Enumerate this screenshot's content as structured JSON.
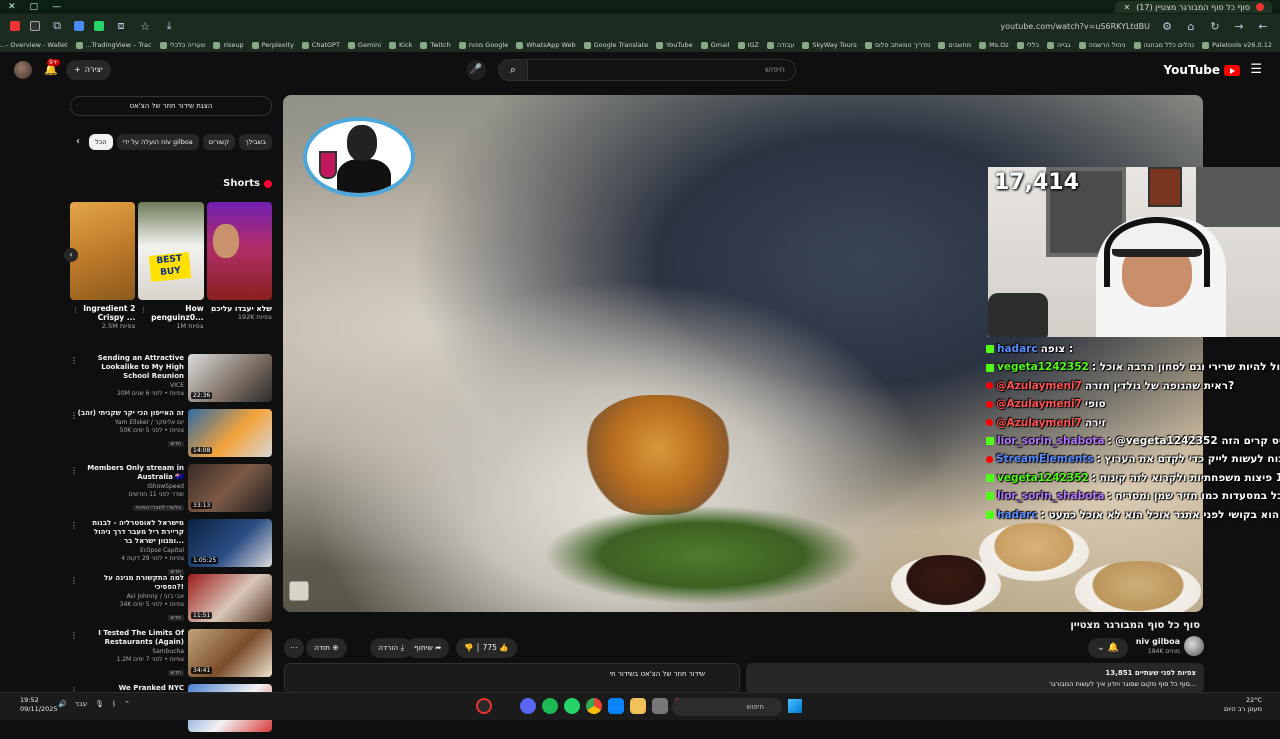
{
  "browser": {
    "tab_title": "(17) סוף כל סוף המבורגר מצטיין",
    "url": "youtube.com/watch?v=uS6RKYLtdBU",
    "bookmarks": [
      "Paletools v26.0.12",
      "נהלים כלל מבחנה",
      "ניהול הרשמה",
      "גבייה",
      "כללי",
      "Ms.Oz",
      "מחשבים",
      "מדריך המאתב פלוס",
      "SkyWay Tours",
      "עבודה",
      "IGZ",
      "Gmail",
      "YouTube",
      "Google Translate",
      "WhatsApp Web",
      "Google מפות",
      "Twitch",
      "Kick",
      "Gemini",
      "ChatGPT",
      "Perplexity",
      "riseup",
      "שעריה כלכלי",
      "TradingView – Trac...",
      "Overview - Wallet -...",
      "אימטרטסקוקים ישראל...",
      "דרך פנס - לוחזר דיווה",
      "עולם כל תכניות נחל..."
    ]
  },
  "masthead": {
    "logo_text": "YouTube",
    "search_placeholder": "חיפוש",
    "search_value": "",
    "create_label": "יצירה",
    "notif_count": "9+"
  },
  "secondary": {
    "live_chat_replay": "הצגת שידור חוזר של הצ'אט",
    "chips": [
      {
        "label": "הכל",
        "active": true
      },
      {
        "label": "הועלה על ידי niv gilboa",
        "active": false
      },
      {
        "label": "קשורים",
        "active": false
      },
      {
        "label": "בשבילך",
        "active": false
      }
    ],
    "shorts_title": "Shorts",
    "shorts": [
      {
        "title": "שלא יעבדו עליכם",
        "views": "192K צפיות"
      },
      {
        "title": "How penguinz0...",
        "views": "1M צפיות"
      },
      {
        "title": "Ingredient 2 Crispy ...",
        "views": "2.5M צפיות"
      }
    ],
    "videos": [
      {
        "title": "Sending an Attractive Lookalike to My High School Reunion",
        "channel": "VICE",
        "stats": "20M צפיות • לפני 6 שנים",
        "duration": "22:36",
        "tag": ""
      },
      {
        "title": "זה האייפון הכי יקר שקניתי (זהב)",
        "channel": "Yam Ellsker / יום אליסקר",
        "stats": "50K צפיות • לפני 5 ימים",
        "duration": "14:08",
        "tag": "חדש"
      },
      {
        "title": "Members Only stream in Australia 🇦🇺",
        "channel": "IShowSpeed",
        "stats": "שודר לפני 11 חודשים",
        "duration": "33:13",
        "tag": "בלעדי לחברי המינוי"
      },
      {
        "title": "מישראל לאוסטרליה - לבנות קריירת ריל מעבר דרך ניהול ומגוון ישראל בר...",
        "channel": "Eclipse Capital",
        "stats": "4 צפיות • לפני 29 דקות",
        "duration": "1:05:25",
        "tag": "חדש"
      },
      {
        "title": "למה התקשורת מגינה על הפסיכי?!",
        "channel": "Avi Johnny / אבי ג'וני",
        "stats": "34K צפיות • לפני 5 ימים",
        "duration": "11:51",
        "tag": "חדש"
      },
      {
        "title": "I Tested The Limits Of Restaurants (Again)",
        "channel": "Sambucha",
        "stats": "1.2M צפיות • לפני 7 ימים",
        "duration": "34:41",
        "tag": "חדש"
      },
      {
        "title": "We Pranked NYC Scammers!",
        "channel": "MindSquare",
        "stats": "",
        "duration": "",
        "tag": ""
      }
    ]
  },
  "overlay": {
    "viewer_count": "17,414",
    "chat": [
      {
        "platform": "kick",
        "user": "hadarc",
        "color": "blue",
        "text": "צופה :"
      },
      {
        "platform": "kick",
        "user": "vegeta1242352",
        "color": "green",
        "text": ": פיס קרים יכול להיות שרירי וגם לסחון הרבה אוכל"
      },
      {
        "platform": "yt",
        "user": "@Azulaymeni7",
        "color": "red",
        "text": "ראית שהגופה של גולדין חזרה?"
      },
      {
        "platform": "yt",
        "user": "@Azulaymeni7",
        "color": "red",
        "text": "סופי"
      },
      {
        "platform": "yt",
        "user": "@Azulaymeni7",
        "color": "red",
        "text": "זירה"
      },
      {
        "platform": "kick",
        "user": "lior_sorin_shabota",
        "color": "purple",
        "text": ": @vegeta1242352 חולה נפש הפיס קרים הזה"
      },
      {
        "platform": "yt",
        "user": "StreamElements",
        "color": "blue",
        "text": ": לא לשכוח לעשות לייק כדי לקדם את הערוץ"
      },
      {
        "platform": "kick",
        "user": "vegeta1242352",
        "color": "green",
        "text": ": דוק איזה 10 פיצות משפחתיות ולקרוא לזה קינוח"
      },
      {
        "platform": "kick",
        "user": "lior_sorin_shabota",
        "color": "purple",
        "text": ": על עשור אוכל במסעדות כמו חזיר שמן ומסריח"
      },
      {
        "platform": "kick",
        "user": "hadarc",
        "color": "blue",
        "text": ": קלוריות וגם הוא בקושי לפני אתגר אוכל הוא לא אוכל כמעט"
      }
    ]
  },
  "video": {
    "title": "סוף כל סוף המבורגר מצטיין",
    "channel_name": "niv gilboa",
    "subscribers": "184K מנויים",
    "likes": "775",
    "share_label": "שיתוף",
    "download_label": "הורדה",
    "thanks_label": "תודה",
    "description_stats": "13,851 צפיות  לפני שעתיים",
    "description_text": "סוף כל סוף מקום שסוגר ויודע איך לעשות המבורגר...",
    "chat_replay_label": "שידור חוזר של הצ'אט בשידור חי"
  },
  "taskbar": {
    "time": "19:52",
    "date": "09/11/2025",
    "lang": "עבר",
    "search_placeholder": "חיפוש",
    "weather_temp": "22°C",
    "weather_desc": "מעונן רב היום"
  },
  "colors": {
    "youtube_red": "#ff0000",
    "kick_green": "#53fc18",
    "background": "#0f0f0f"
  }
}
